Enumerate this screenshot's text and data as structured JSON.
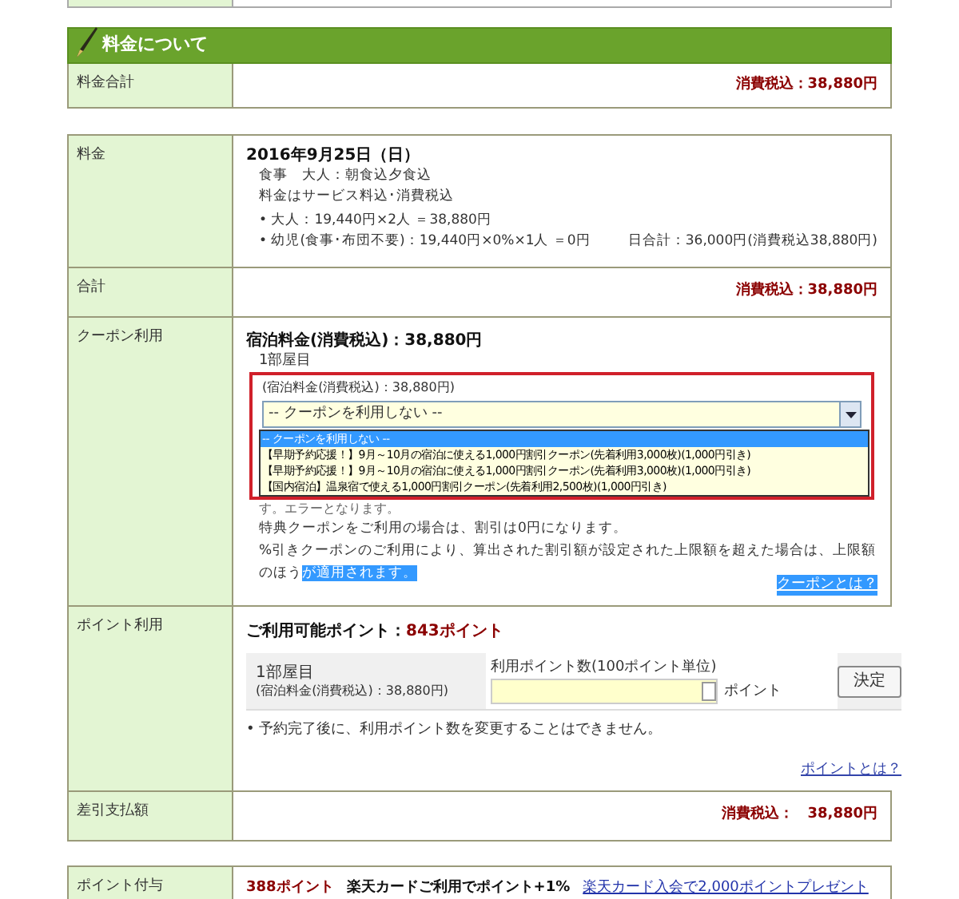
{
  "section_header": {
    "title": "料金について"
  },
  "total_row": {
    "label": "料金合計",
    "value": "消費税込：38,880円"
  },
  "fee": {
    "label": "料金",
    "date": "2016年9月25日（日）",
    "meal": "食事　大人：朝食込夕食込",
    "note": "料金はサービス料込･消費税込",
    "lines": [
      "• 大人：19,440円×2人 ＝38,880円",
      "• 幼児(食事･布団不要)：19,440円×0%×1人 ＝0円"
    ],
    "day_total": "日合計：36,000円(消費税込38,880円)"
  },
  "sum_row": {
    "label": "合計",
    "value": "消費税込：38,880円"
  },
  "coupon": {
    "label": "クーポン利用",
    "price": "宿泊料金(消費税込)：38,880円",
    "room": "1部屋目",
    "room_price": "(宿泊料金(消費税込)：38,880円)",
    "select_value": "-- クーポンを利用しない --",
    "options": [
      {
        "label": "-- クーポンを利用しない --",
        "selected": true
      },
      {
        "label": "【早期予約応援！】9月～10月の宿泊に使える1,000円割引クーポン(先着利用3,000枚)(1,000円引き)",
        "selected": false
      },
      {
        "label": "【早期予約応援！】9月～10月の宿泊に使える1,000円割引クーポン(先着利用3,000枚)(1,000円引き)",
        "selected": false
      },
      {
        "label": "【国内宿泊】温泉宿で使える1,000円割引クーポン(先着利用2,500枚)(1,000円引き)",
        "selected": false
      }
    ],
    "partial_note": "す。エラーとなります。",
    "notes": [
      {
        "text": "特典クーポンをご利用の場合は、割引は0円になります。"
      },
      {
        "text": "%引きクーポンのご利用により、算出された割引額が設定された上限額を超えた場合は、上限額のほう",
        "highlighted": "が適用されます。"
      }
    ],
    "help_link": {
      "text": "クーポンとは？",
      "highlighted": true
    }
  },
  "points": {
    "label": "ポイント利用",
    "available_label": "ご利用可能ポイント：",
    "available_value": "843ポイント",
    "room": "1部屋目",
    "room_price": "(宿泊料金(消費税込)：38,880円)",
    "input_label": "利用ポイント数(100ポイント単位)",
    "unit": "ポイント",
    "button": "決定",
    "notice": "• 予約完了後に、利用ポイント数を変更することはできません。",
    "help_link": "ポイントとは？"
  },
  "payment_row": {
    "label": "差引支払額",
    "value": "消費税込：　38,880円"
  },
  "award_row": {
    "label": "ポイント付与",
    "points": "388ポイント",
    "card_note": "楽天カードご利用でポイント+1%",
    "link": "楽天カード入会で2,000ポイントプレゼント"
  }
}
